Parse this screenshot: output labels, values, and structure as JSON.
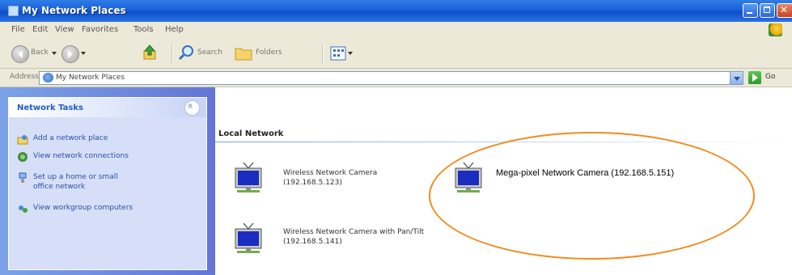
{
  "window": {
    "title": "My Network Places"
  },
  "menu": [
    "File",
    "Edit",
    "View",
    "Favorites",
    "Tools",
    "Help"
  ],
  "toolbar": {
    "back": "Back",
    "search": "Search",
    "folders": "Folders"
  },
  "address": {
    "label": "Address",
    "value": "My Network Places",
    "go": "Go"
  },
  "tasks": {
    "header": "Network Tasks",
    "items": [
      "Add a network place",
      "View network connections",
      "Set up a home or small office network",
      "View workgroup computers"
    ]
  },
  "main": {
    "group": "Local Network",
    "items": [
      "Wireless Network Camera (192.168.5.123)",
      "Mega-pixel Network Camera (192.168.5.151)",
      "Wireless Network Camera with Pan/Tilt (192.168.5.141)"
    ]
  },
  "colors": {
    "titlebar": "#0e4ec6",
    "highlight": "#f08c1e",
    "taskpane": "#6375d6"
  }
}
